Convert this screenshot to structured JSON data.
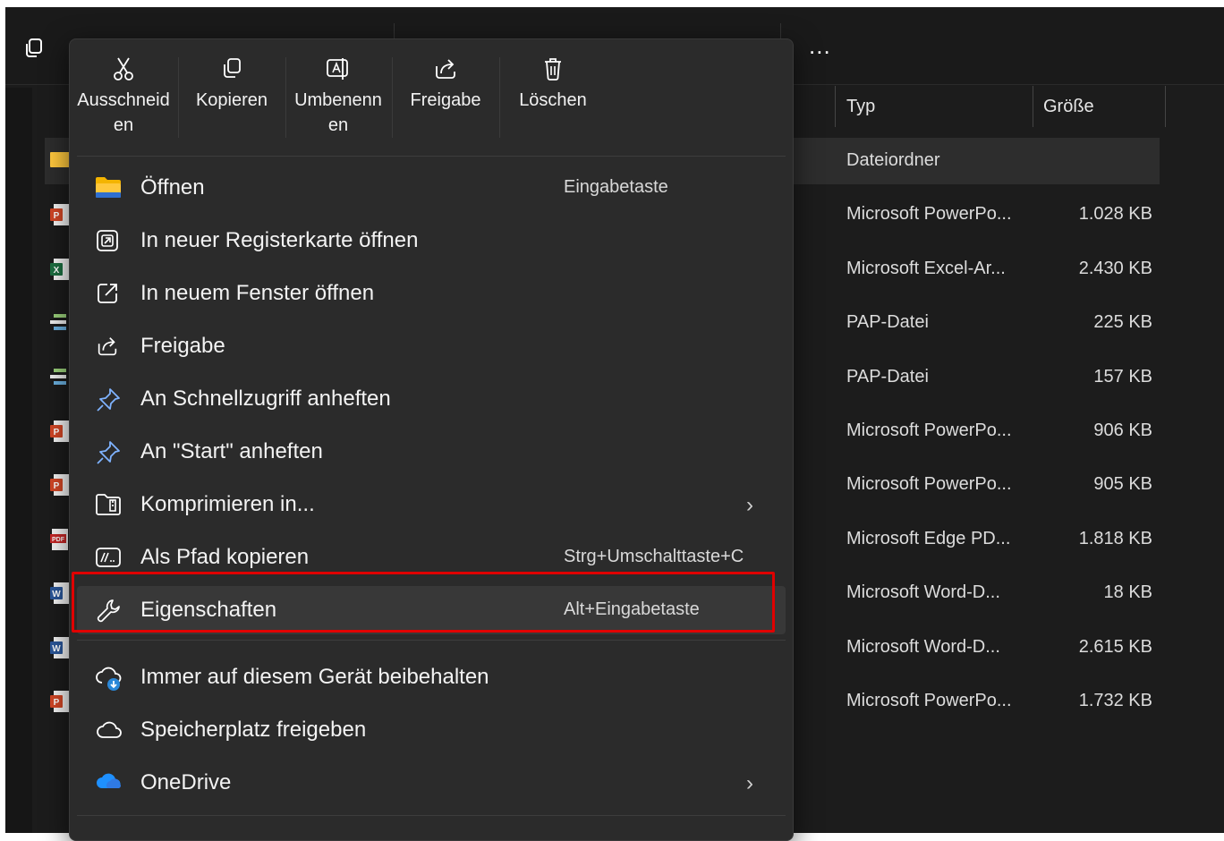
{
  "quick_actions": [
    {
      "label": "Ausschneiden",
      "icon": "scissors-icon"
    },
    {
      "label": "Kopieren",
      "icon": "copy-icon"
    },
    {
      "label": "Umbenennen",
      "icon": "rename-icon"
    },
    {
      "label": "Freigabe",
      "icon": "share-icon"
    },
    {
      "label": "Löschen",
      "icon": "trash-icon"
    }
  ],
  "menu_items": [
    {
      "label": "Öffnen",
      "shortcut": "Eingabetaste",
      "icon": "folder-icon"
    },
    {
      "label": "In neuer Registerkarte öffnen",
      "shortcut": "",
      "icon": "new-tab-icon"
    },
    {
      "label": "In neuem Fenster öffnen",
      "shortcut": "",
      "icon": "new-window-icon"
    },
    {
      "label": "Freigabe",
      "shortcut": "",
      "icon": "share-icon"
    },
    {
      "label": "An Schnellzugriff anheften",
      "shortcut": "",
      "icon": "pin-icon"
    },
    {
      "label": "An \"Start\" anheften",
      "shortcut": "",
      "icon": "pin-icon"
    },
    {
      "label": "Komprimieren in...",
      "shortcut": "",
      "icon": "zip-icon",
      "submenu": true
    },
    {
      "label": "Als Pfad kopieren",
      "shortcut": "Strg+Umschalttaste+C",
      "icon": "path-icon"
    },
    {
      "label": "Eigenschaften",
      "shortcut": "Alt+Eingabetaste",
      "icon": "wrench-icon",
      "highlighted": true
    }
  ],
  "cloud_items": [
    {
      "label": "Immer auf diesem Gerät beibehalten",
      "icon": "cloud-download-icon"
    },
    {
      "label": "Speicherplatz freigeben",
      "icon": "cloud-icon"
    },
    {
      "label": "OneDrive",
      "icon": "onedrive-icon",
      "submenu": true
    }
  ],
  "columns": {
    "type": "Typ",
    "size": "Größe"
  },
  "files": [
    {
      "type": "Dateiordner",
      "size": "",
      "icon": "folder-icon",
      "selected": true
    },
    {
      "type": "Microsoft PowerPo...",
      "size": "1.028 KB",
      "icon": "powerpoint-icon"
    },
    {
      "type": "Microsoft Excel-Ar...",
      "size": "2.430 KB",
      "icon": "excel-icon"
    },
    {
      "type": "PAP-Datei",
      "size": "225 KB",
      "icon": "pap-icon"
    },
    {
      "type": "PAP-Datei",
      "size": "157 KB",
      "icon": "pap-icon"
    },
    {
      "type": "Microsoft PowerPo...",
      "size": "906 KB",
      "icon": "powerpoint-icon"
    },
    {
      "type": "Microsoft PowerPo...",
      "size": "905 KB",
      "icon": "powerpoint-icon"
    },
    {
      "type": "Microsoft Edge PD...",
      "size": "1.818 KB",
      "icon": "pdf-icon"
    },
    {
      "type": "Microsoft Word-D...",
      "size": "18 KB",
      "icon": "word-icon"
    },
    {
      "type": "Microsoft Word-D...",
      "size": "2.615 KB",
      "icon": "word-icon"
    },
    {
      "type": "Microsoft PowerPo...",
      "size": "1.732 KB",
      "icon": "powerpoint-icon"
    }
  ],
  "toolbar": {
    "more_label": "..."
  },
  "colors": {
    "highlight_border": "#e00000",
    "menu_bg": "#2b2b2b",
    "window_bg": "#1c1c1c"
  }
}
